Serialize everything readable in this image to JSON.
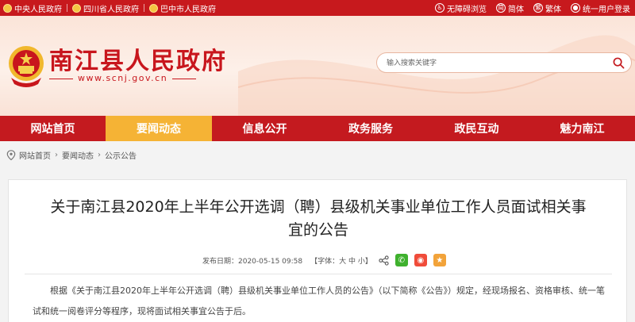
{
  "topbar": {
    "links": [
      "中央人民政府",
      "四川省人民政府",
      "巴中市人民政府"
    ],
    "accessible": "无障碍浏览",
    "simplified": "简体",
    "traditional": "繁体",
    "login": "统一用户登录"
  },
  "header": {
    "title": "南江县人民政府",
    "domain": "www.scnj.gov.cn"
  },
  "search": {
    "placeholder": "输入搜索关键字"
  },
  "nav": {
    "items": [
      {
        "label": "网站首页"
      },
      {
        "label": "要闻动态"
      },
      {
        "label": "信息公开"
      },
      {
        "label": "政务服务"
      },
      {
        "label": "政民互动"
      },
      {
        "label": "魅力南江"
      }
    ],
    "active_index": 1
  },
  "breadcrumb": [
    "网站首页",
    "要闻动态",
    "公示公告"
  ],
  "article": {
    "title_line1": "关于南江县2020年上半年公开选调（聘）县级机关事业单位工作人员面试相关事",
    "title_line2": "宜的公告",
    "date": "发布日期：2020-05-15 09:58",
    "font_size": "【字体：大 中 小】",
    "body": "根据《关于南江县2020年上半年公开选调（聘）县级机关事业单位工作人员的公告》（以下简称《公告》）规定，经现场报名、资格审核、统一笔试和统一阅卷评分等程序，现将面试相关事宜公告于后。"
  },
  "colors": {
    "brand_red": "#c41a1f",
    "active_tab": "#f5b335",
    "header_bg": "#fbe4d8"
  }
}
